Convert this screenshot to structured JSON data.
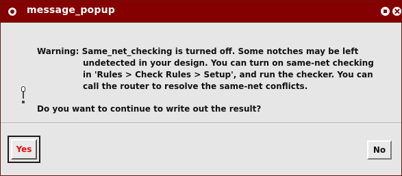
{
  "window": {
    "title": "message_popup"
  },
  "message": {
    "lines": [
      "Warning: Same_net_checking is turned off.  Some notches may be left",
      "undetected in your design.  You can turn on same-net checking",
      "in 'Rules > Check Rules > Setup', and run the checker.  You can",
      "call the router to resolve the same-net conflicts."
    ],
    "question": "Do you want to continue to write out the result?",
    "icon": "exclamation-icon"
  },
  "buttons": {
    "yes_label": "Yes",
    "no_label": "No"
  },
  "colors": {
    "titlebar": "#850000",
    "default_button_text": "#e01010",
    "dialog_background": "#e6e6e6"
  }
}
